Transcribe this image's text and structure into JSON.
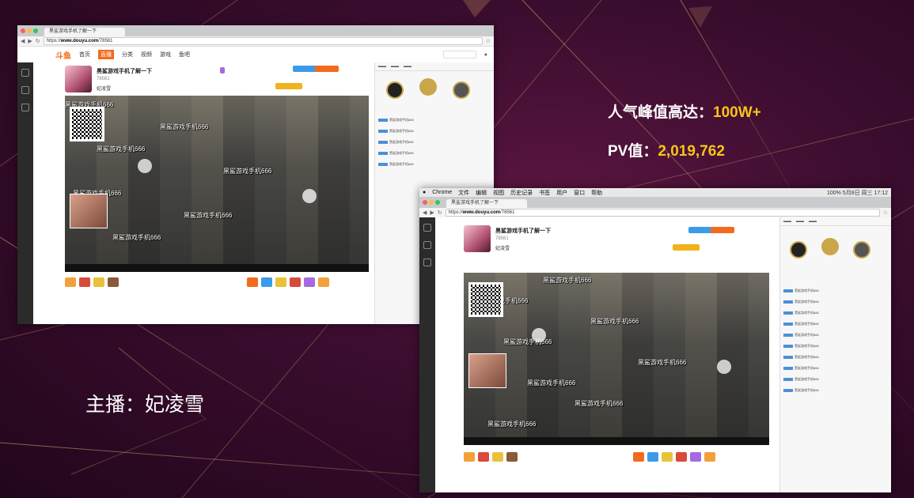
{
  "stats": {
    "peak_label": "人气峰值高达：",
    "peak_value": "100W+",
    "pv_label": "PV值：",
    "pv_value": "2,019,762"
  },
  "anchor": {
    "label": "主播：",
    "name": "妃凌雪"
  },
  "browser": {
    "url_prefix": "https://",
    "url_domain": "www.douyu.com",
    "url_path": "/78561",
    "nav_items": [
      "首页",
      "直播",
      "分类",
      "视频",
      "游戏",
      "鱼吧"
    ]
  },
  "mac_menu": {
    "items": [
      "Chrome",
      "文件",
      "编辑",
      "视图",
      "历史记录",
      "书签",
      "用户",
      "窗口",
      "帮助"
    ],
    "status": "100%  5月8日 周三 17:12"
  },
  "room": {
    "title": "黑鲨游戏手机了解一下",
    "streamer": "妃凌雪",
    "room_id": "78561"
  },
  "danmaku_text": "黑鲨游戏手机666",
  "colors": {
    "accent": "#f26b1d",
    "stat_highlight": "#f5c518",
    "background": "#3a0d2e"
  }
}
